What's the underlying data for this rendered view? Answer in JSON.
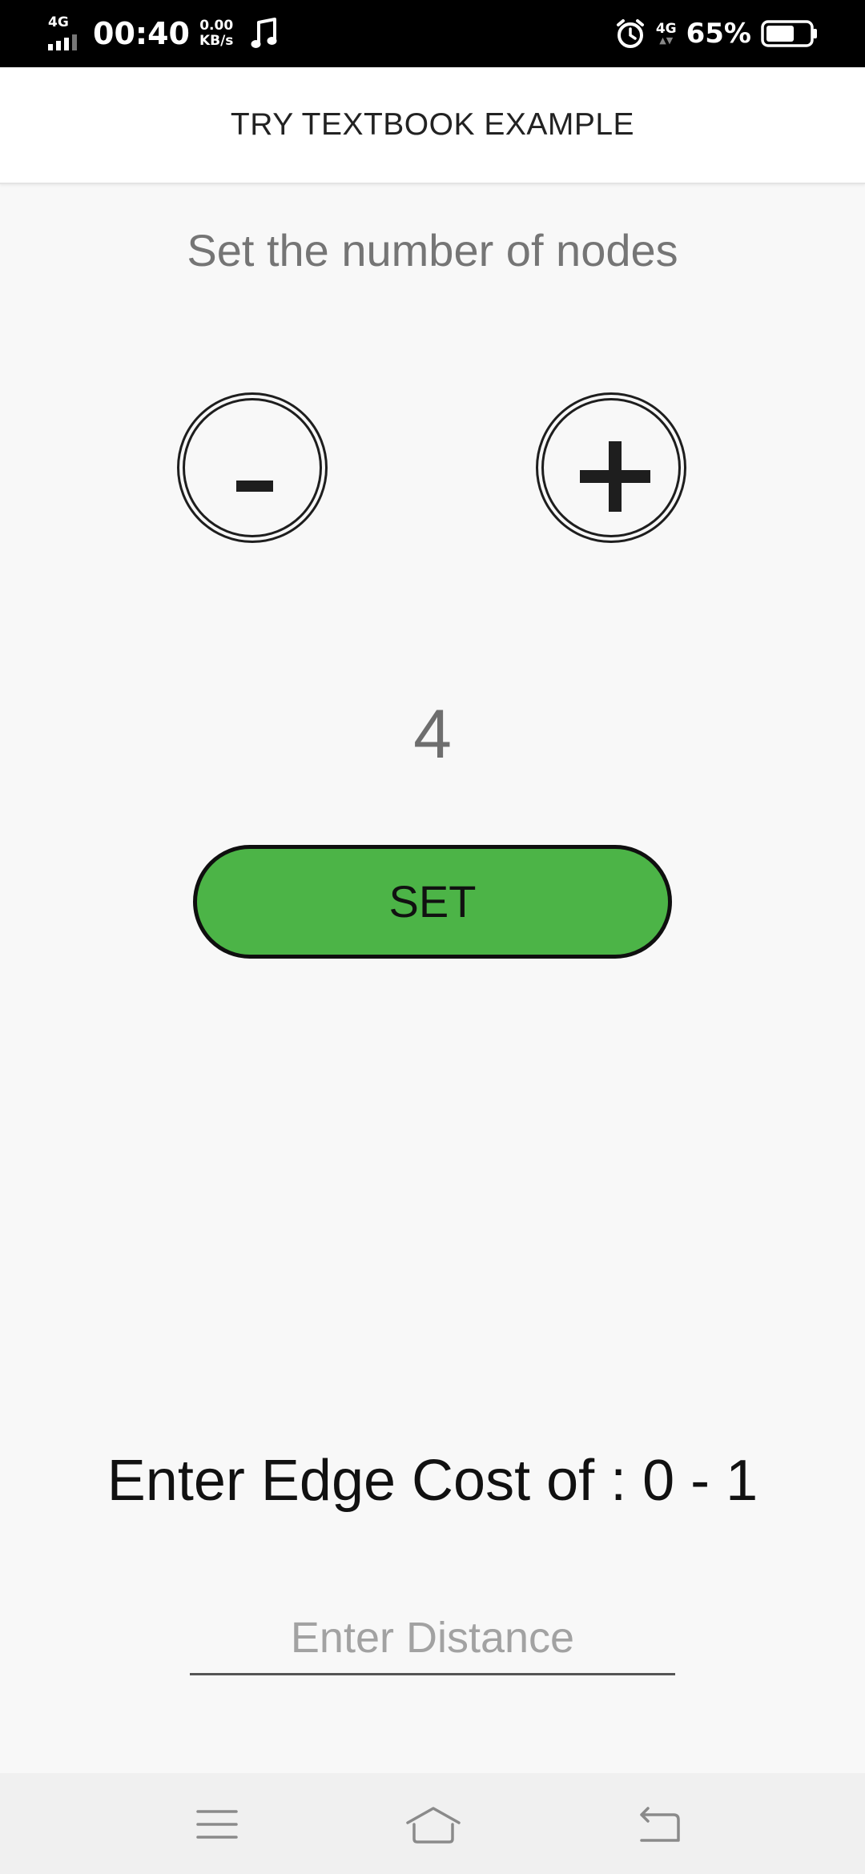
{
  "status_bar": {
    "network_left": "4G",
    "time": "00:40",
    "speed_value": "0.00",
    "speed_unit": "KB/s",
    "network_right": "4G",
    "battery_percent": "65%",
    "battery_level": 0.65,
    "icons": [
      "signal-icon",
      "music-note-icon",
      "alarm-icon",
      "battery-icon"
    ]
  },
  "header": {
    "title": "TRY TEXTBOOK EXAMPLE"
  },
  "nodes": {
    "prompt": "Set the number of nodes",
    "decrement_label": "-",
    "increment_label": "+",
    "count": "4",
    "set_label": "SET"
  },
  "edge": {
    "label": "Enter Edge Cost of : 0 - 1",
    "input_value": "",
    "input_placeholder": "Enter Distance"
  },
  "nav_bar": {
    "icons": [
      "menu-icon",
      "home-icon",
      "back-icon"
    ]
  },
  "colors": {
    "set_button": "#4cb447",
    "background": "#f8f8f8",
    "status_bar": "#000000"
  }
}
